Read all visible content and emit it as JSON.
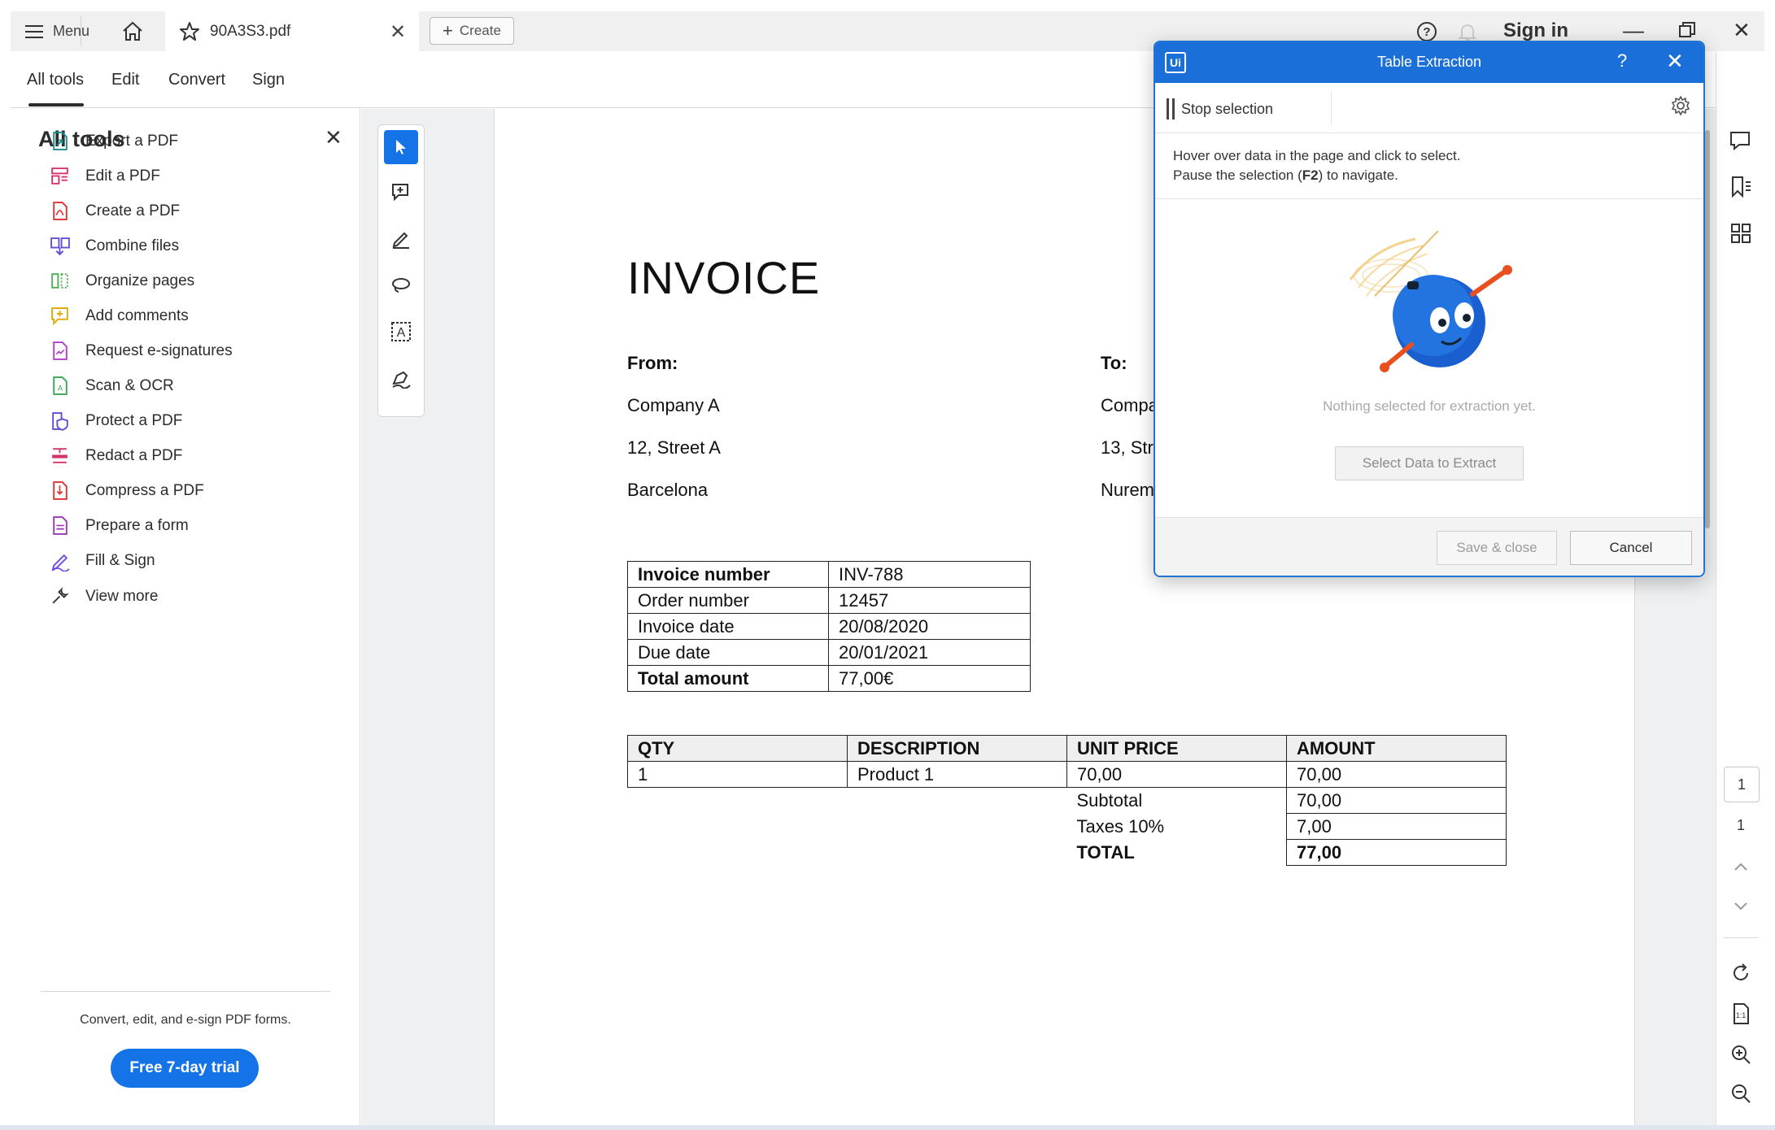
{
  "titlebar": {
    "menu_label": "Menu",
    "doc_tab_name": "90A3S3.pdf",
    "create_label": "Create",
    "sign_in": "Sign in"
  },
  "toolrow": {
    "tabs": [
      "All tools",
      "Edit",
      "Convert",
      "Sign"
    ],
    "active": "All tools"
  },
  "left_panel": {
    "title": "All tools",
    "items": [
      {
        "label": "Export a PDF",
        "icon": "export-pdf-icon",
        "color": "#1a8c8c"
      },
      {
        "label": "Edit a PDF",
        "icon": "edit-pdf-icon",
        "color": "#d6336c"
      },
      {
        "label": "Create a PDF",
        "icon": "create-pdf-icon",
        "color": "#e03131"
      },
      {
        "label": "Combine files",
        "icon": "combine-files-icon",
        "color": "#5c4fd6"
      },
      {
        "label": "Organize pages",
        "icon": "organize-pages-icon",
        "color": "#4caf50"
      },
      {
        "label": "Add comments",
        "icon": "add-comments-icon",
        "color": "#e0a800"
      },
      {
        "label": "Request e-signatures",
        "icon": "request-esign-icon",
        "color": "#b23cc9"
      },
      {
        "label": "Scan & OCR",
        "icon": "scan-ocr-icon",
        "color": "#3aa655"
      },
      {
        "label": "Protect a PDF",
        "icon": "protect-pdf-icon",
        "color": "#5c4fd6"
      },
      {
        "label": "Redact a PDF",
        "icon": "redact-pdf-icon",
        "color": "#d6336c"
      },
      {
        "label": "Compress a PDF",
        "icon": "compress-pdf-icon",
        "color": "#e03131"
      },
      {
        "label": "Prepare a form",
        "icon": "prepare-form-icon",
        "color": "#9c36b5"
      },
      {
        "label": "Fill & Sign",
        "icon": "fill-sign-icon",
        "color": "#7048e8"
      },
      {
        "label": "View more",
        "icon": "view-more-icon",
        "color": "#333333"
      }
    ],
    "promo": "Convert, edit, and e-sign PDF forms.",
    "trial_button": "Free 7-day trial"
  },
  "invoice": {
    "title": "INVOICE",
    "from_label": "From:",
    "to_label": "To:",
    "from_lines": [
      "Company A",
      "12, Street A",
      "Barcelona"
    ],
    "to_lines": [
      "Compa",
      "13, Str",
      "Nurem"
    ],
    "info_rows": [
      [
        "Invoice number",
        "INV-788"
      ],
      [
        "Order number",
        "12457"
      ],
      [
        "Invoice date",
        "20/08/2020"
      ],
      [
        "Due date",
        "20/01/2021"
      ],
      [
        "Total amount",
        "77,00€"
      ]
    ],
    "items_header": [
      "QTY",
      "DESCRIPTION",
      "UNIT PRICE",
      "AMOUNT"
    ],
    "items_row": [
      "1",
      "Product 1",
      "70,00",
      "70,00"
    ],
    "subtotal_label": "Subtotal",
    "subtotal_value": "70,00",
    "taxes_label": "Taxes 10%",
    "taxes_value": "7,00",
    "total_label": "TOTAL",
    "total_value": "77,00"
  },
  "right_sidebar": {
    "current_page": "1",
    "total_pages": "1"
  },
  "dialog": {
    "logo": "Ui",
    "title": "Table Extraction",
    "help": "?",
    "stop_selection": "Stop selection",
    "instr_line1": "Hover over data in the page and click to select.",
    "instr_line2_a": "Pause the selection (",
    "instr_line2_key": "F2",
    "instr_line2_b": ") to navigate.",
    "nothing_selected": "Nothing selected for extraction yet.",
    "select_button": "Select Data to Extract",
    "save_button": "Save & close",
    "cancel_button": "Cancel"
  },
  "colors": {
    "accent": "#1473e6",
    "dialog_header": "#1a6fd8"
  }
}
